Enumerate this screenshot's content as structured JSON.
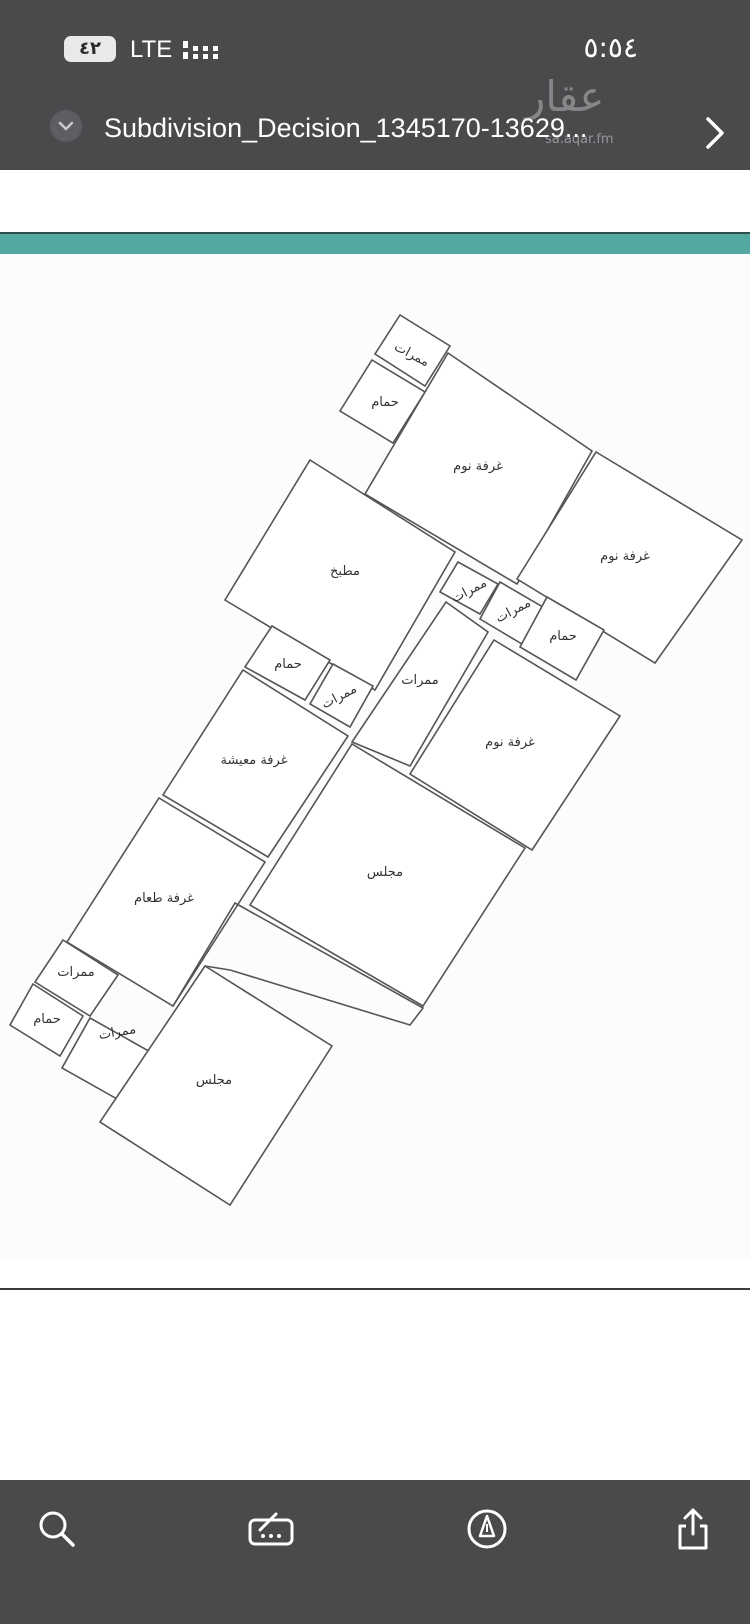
{
  "status_bar": {
    "battery": "٤٢",
    "network": "LTE",
    "time": "٥:٥٤"
  },
  "header": {
    "title": "Subdivision_Decision_1345170-13629...",
    "watermark": "عقار",
    "watermark_sub": "sa.aqar.fm"
  },
  "floor_plan": {
    "labels": {
      "corridor_1": "ممرات",
      "bath_1": "حمام",
      "bedroom_1": "غرفة نوم",
      "bedroom_2": "غرفة نوم",
      "kitchen": "مطبخ",
      "corridor_2": "ممرات",
      "corridor_3": "ممرات",
      "bath_2": "حمام",
      "bath_3": "حمام",
      "corridor_4": "ممرات",
      "corridor_5": "ممرات",
      "bedroom_3": "غرفة نوم",
      "living_room": "غرفة معيشة",
      "majlis_1": "مجلس",
      "dining_room": "غرفة طعام",
      "corridor_6": "ممرات",
      "bath_4": "حمام",
      "corridor_7": "ممرات",
      "majlis_2": "مجلس"
    }
  },
  "toolbar": {
    "icons": [
      "search-icon",
      "markup-icon",
      "pen-circle-icon",
      "share-icon"
    ]
  },
  "colors": {
    "bar_bg": "#4a4a4d",
    "teal_accent": "#53a89f"
  }
}
